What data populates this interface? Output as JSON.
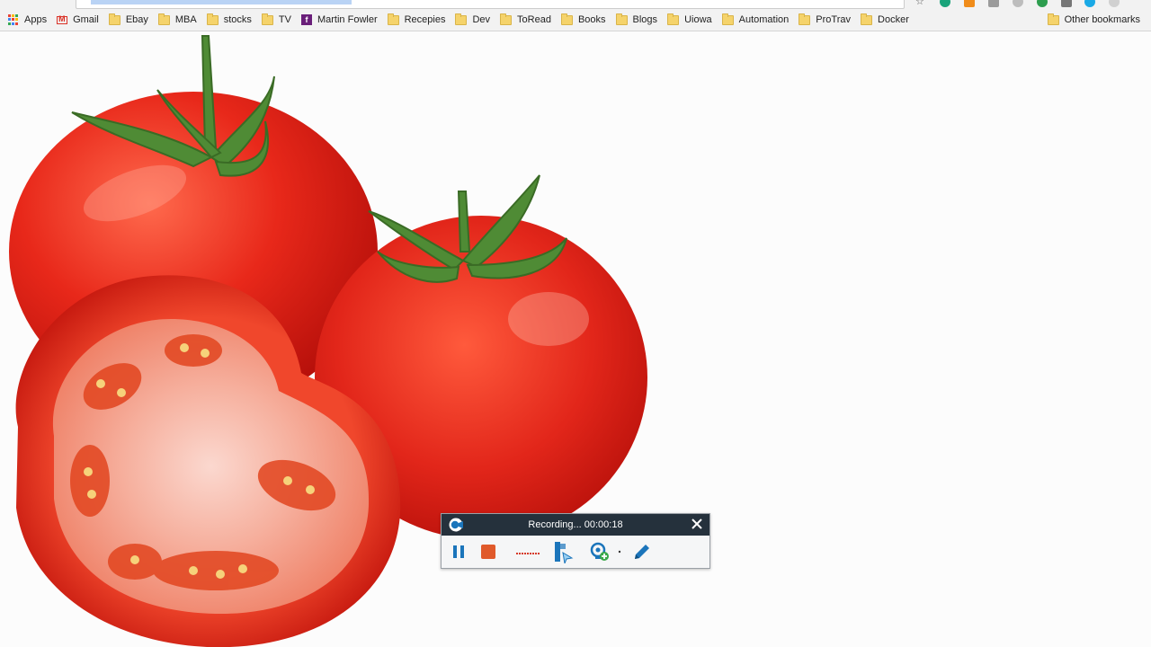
{
  "bookmarks": {
    "items": [
      {
        "label": "Apps",
        "icon": "apps-grid-icon"
      },
      {
        "label": "Gmail",
        "icon": "gmail-icon"
      },
      {
        "label": "Ebay",
        "icon": "folder-icon"
      },
      {
        "label": "MBA",
        "icon": "folder-icon"
      },
      {
        "label": "stocks",
        "icon": "folder-icon"
      },
      {
        "label": "TV",
        "icon": "folder-icon"
      },
      {
        "label": "Martin Fowler",
        "icon": "fowler-icon"
      },
      {
        "label": "Recepies",
        "icon": "folder-icon"
      },
      {
        "label": "Dev",
        "icon": "folder-icon"
      },
      {
        "label": "ToRead",
        "icon": "folder-icon"
      },
      {
        "label": "Books",
        "icon": "folder-icon"
      },
      {
        "label": "Blogs",
        "icon": "folder-icon"
      },
      {
        "label": "Uiowa",
        "icon": "folder-icon"
      },
      {
        "label": "Automation",
        "icon": "folder-icon"
      },
      {
        "label": "ProTrav",
        "icon": "folder-icon"
      },
      {
        "label": "Docker",
        "icon": "folder-icon"
      }
    ],
    "other": "Other bookmarks"
  },
  "recorder": {
    "status": "Recording... 00:00:18",
    "accent": "#1b75bb",
    "stop_color": "#e05a2b",
    "tools": [
      "pause-icon",
      "stop-icon",
      "audio-level-icon",
      "cursor-highlight-icon",
      "webcam-icon",
      "pen-icon"
    ]
  },
  "colors": {
    "bookmark_bar": "#f2f2f2",
    "recorder_header": "#25313c"
  }
}
